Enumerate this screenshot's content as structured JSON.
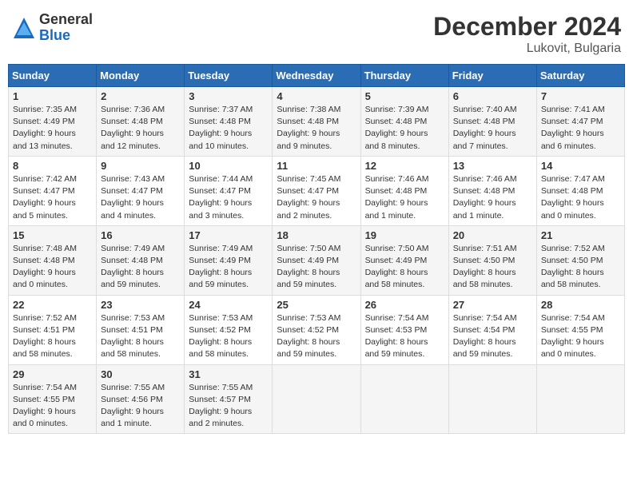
{
  "header": {
    "logo_general": "General",
    "logo_blue": "Blue",
    "month_year": "December 2024",
    "location": "Lukovit, Bulgaria"
  },
  "weekdays": [
    "Sunday",
    "Monday",
    "Tuesday",
    "Wednesday",
    "Thursday",
    "Friday",
    "Saturday"
  ],
  "weeks": [
    [
      {
        "day": 1,
        "sunrise": "7:35 AM",
        "sunset": "4:49 PM",
        "daylight": "9 hours and 13 minutes"
      },
      {
        "day": 2,
        "sunrise": "7:36 AM",
        "sunset": "4:48 PM",
        "daylight": "9 hours and 12 minutes"
      },
      {
        "day": 3,
        "sunrise": "7:37 AM",
        "sunset": "4:48 PM",
        "daylight": "9 hours and 10 minutes"
      },
      {
        "day": 4,
        "sunrise": "7:38 AM",
        "sunset": "4:48 PM",
        "daylight": "9 hours and 9 minutes"
      },
      {
        "day": 5,
        "sunrise": "7:39 AM",
        "sunset": "4:48 PM",
        "daylight": "9 hours and 8 minutes"
      },
      {
        "day": 6,
        "sunrise": "7:40 AM",
        "sunset": "4:48 PM",
        "daylight": "9 hours and 7 minutes"
      },
      {
        "day": 7,
        "sunrise": "7:41 AM",
        "sunset": "4:47 PM",
        "daylight": "9 hours and 6 minutes"
      }
    ],
    [
      {
        "day": 8,
        "sunrise": "7:42 AM",
        "sunset": "4:47 PM",
        "daylight": "9 hours and 5 minutes"
      },
      {
        "day": 9,
        "sunrise": "7:43 AM",
        "sunset": "4:47 PM",
        "daylight": "9 hours and 4 minutes"
      },
      {
        "day": 10,
        "sunrise": "7:44 AM",
        "sunset": "4:47 PM",
        "daylight": "9 hours and 3 minutes"
      },
      {
        "day": 11,
        "sunrise": "7:45 AM",
        "sunset": "4:47 PM",
        "daylight": "9 hours and 2 minutes"
      },
      {
        "day": 12,
        "sunrise": "7:46 AM",
        "sunset": "4:48 PM",
        "daylight": "9 hours and 1 minute"
      },
      {
        "day": 13,
        "sunrise": "7:46 AM",
        "sunset": "4:48 PM",
        "daylight": "9 hours and 1 minute"
      },
      {
        "day": 14,
        "sunrise": "7:47 AM",
        "sunset": "4:48 PM",
        "daylight": "9 hours and 0 minutes"
      }
    ],
    [
      {
        "day": 15,
        "sunrise": "7:48 AM",
        "sunset": "4:48 PM",
        "daylight": "9 hours and 0 minutes"
      },
      {
        "day": 16,
        "sunrise": "7:49 AM",
        "sunset": "4:48 PM",
        "daylight": "8 hours and 59 minutes"
      },
      {
        "day": 17,
        "sunrise": "7:49 AM",
        "sunset": "4:49 PM",
        "daylight": "8 hours and 59 minutes"
      },
      {
        "day": 18,
        "sunrise": "7:50 AM",
        "sunset": "4:49 PM",
        "daylight": "8 hours and 59 minutes"
      },
      {
        "day": 19,
        "sunrise": "7:50 AM",
        "sunset": "4:49 PM",
        "daylight": "8 hours and 58 minutes"
      },
      {
        "day": 20,
        "sunrise": "7:51 AM",
        "sunset": "4:50 PM",
        "daylight": "8 hours and 58 minutes"
      },
      {
        "day": 21,
        "sunrise": "7:52 AM",
        "sunset": "4:50 PM",
        "daylight": "8 hours and 58 minutes"
      }
    ],
    [
      {
        "day": 22,
        "sunrise": "7:52 AM",
        "sunset": "4:51 PM",
        "daylight": "8 hours and 58 minutes"
      },
      {
        "day": 23,
        "sunrise": "7:53 AM",
        "sunset": "4:51 PM",
        "daylight": "8 hours and 58 minutes"
      },
      {
        "day": 24,
        "sunrise": "7:53 AM",
        "sunset": "4:52 PM",
        "daylight": "8 hours and 58 minutes"
      },
      {
        "day": 25,
        "sunrise": "7:53 AM",
        "sunset": "4:52 PM",
        "daylight": "8 hours and 59 minutes"
      },
      {
        "day": 26,
        "sunrise": "7:54 AM",
        "sunset": "4:53 PM",
        "daylight": "8 hours and 59 minutes"
      },
      {
        "day": 27,
        "sunrise": "7:54 AM",
        "sunset": "4:54 PM",
        "daylight": "8 hours and 59 minutes"
      },
      {
        "day": 28,
        "sunrise": "7:54 AM",
        "sunset": "4:55 PM",
        "daylight": "9 hours and 0 minutes"
      }
    ],
    [
      {
        "day": 29,
        "sunrise": "7:54 AM",
        "sunset": "4:55 PM",
        "daylight": "9 hours and 0 minutes"
      },
      {
        "day": 30,
        "sunrise": "7:55 AM",
        "sunset": "4:56 PM",
        "daylight": "9 hours and 1 minute"
      },
      {
        "day": 31,
        "sunrise": "7:55 AM",
        "sunset": "4:57 PM",
        "daylight": "9 hours and 2 minutes"
      },
      null,
      null,
      null,
      null
    ]
  ]
}
